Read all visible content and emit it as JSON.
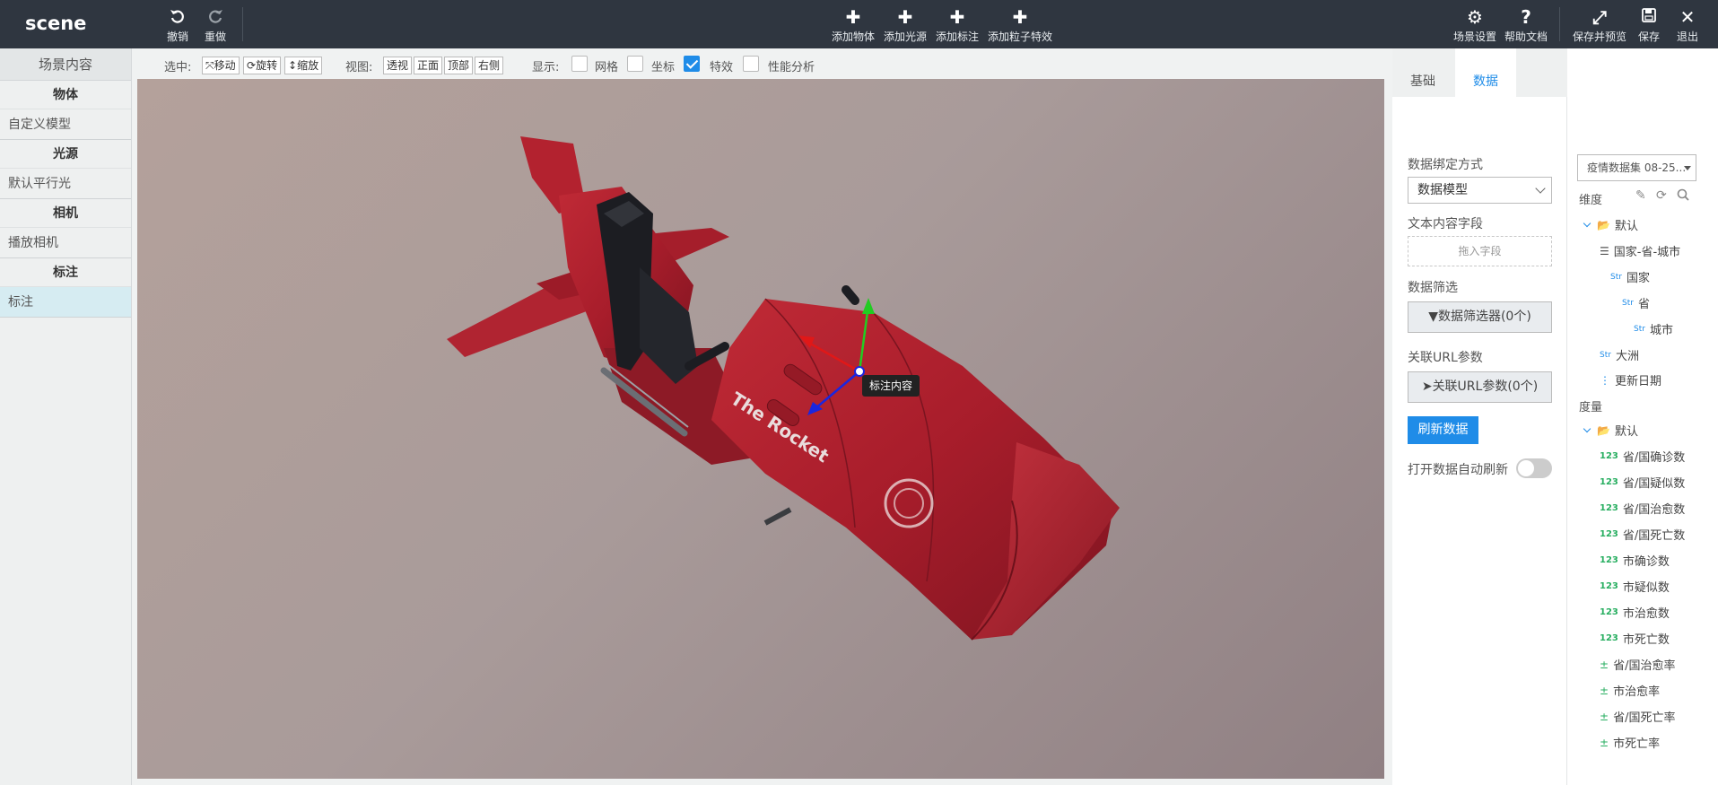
{
  "app": {
    "logo": "scene"
  },
  "topbar": {
    "undo": "撤销",
    "redo": "重做",
    "add_object": "添加物体",
    "add_light": "添加光源",
    "add_label": "添加标注",
    "add_particle": "添加粒子特效",
    "scene_settings": "场景设置",
    "help_docs": "帮助文档",
    "save_preview": "保存并预览",
    "save": "保存",
    "exit": "退出"
  },
  "left_panel": {
    "title": "场景内容",
    "groups": [
      {
        "name": "物体",
        "items": [
          "自定义模型"
        ]
      },
      {
        "name": "光源",
        "items": [
          "默认平行光"
        ]
      },
      {
        "name": "相机",
        "items": [
          "播放相机"
        ]
      },
      {
        "name": "标注",
        "items": [
          "标注"
        ]
      }
    ]
  },
  "toolbar": {
    "select_label": "选中:",
    "move": "移动",
    "rotate": "旋转",
    "scale": "缩放",
    "view_label": "视图:",
    "perspective": "透视",
    "front": "正面",
    "top": "顶部",
    "right": "右侧",
    "display_label": "显示:",
    "grid": "网格",
    "axes": "坐标",
    "effects": "特效",
    "perf": "性能分析",
    "grid_checked": false,
    "axes_checked": false,
    "effects_checked": true,
    "perf_checked": false
  },
  "viewport": {
    "label_text": "标注内容",
    "model_text": "The Rocket"
  },
  "right_panel": {
    "tabs": [
      "基础",
      "数据"
    ],
    "active_tab": "数据",
    "bind_mode_label": "数据绑定方式",
    "bind_mode_value": "数据模型",
    "text_field_label": "文本内容字段",
    "drop_placeholder": "拖入字段",
    "filter_label": "数据筛选",
    "filter_button": "数据筛选器(0个)",
    "url_label": "关联URL参数",
    "url_button": "关联URL参数(0个)",
    "refresh_button": "刷新数据",
    "auto_refresh_label": "打开数据自动刷新",
    "auto_refresh_on": false
  },
  "fields": {
    "dataset": "疫情数据集 08-25...",
    "dimension_label": "维度",
    "measure_label": "度量",
    "dimensions": [
      {
        "type": "folder",
        "name": "默认"
      },
      {
        "type": "hier",
        "name": "国家-省-城市"
      },
      {
        "type": "Str",
        "name": "国家"
      },
      {
        "type": "Str",
        "name": "省"
      },
      {
        "type": "Str",
        "name": "城市"
      },
      {
        "type": "Str",
        "name": "大洲"
      },
      {
        "type": "date",
        "name": "更新日期"
      }
    ],
    "measures": [
      {
        "type": "folder",
        "name": "默认"
      },
      {
        "type": "123",
        "name": "省/国确诊数"
      },
      {
        "type": "123",
        "name": "省/国疑似数"
      },
      {
        "type": "123",
        "name": "省/国治愈数"
      },
      {
        "type": "123",
        "name": "省/国死亡数"
      },
      {
        "type": "123",
        "name": "市确诊数"
      },
      {
        "type": "123",
        "name": "市疑似数"
      },
      {
        "type": "123",
        "name": "市治愈数"
      },
      {
        "type": "123",
        "name": "市死亡数"
      },
      {
        "type": "calc",
        "name": "省/国治愈率"
      },
      {
        "type": "calc",
        "name": "市治愈率"
      },
      {
        "type": "calc",
        "name": "省/国死亡率"
      },
      {
        "type": "calc",
        "name": "市死亡率"
      }
    ]
  },
  "icons": {
    "undo": "undo-icon",
    "redo": "redo-icon",
    "plus": "plus-icon",
    "gear": "gear-icon",
    "help": "question-icon",
    "expand": "expand-icon",
    "save": "floppy-icon",
    "close": "close-icon"
  },
  "colors": {
    "topbar": "#2f3640",
    "accent": "#1f8ce8",
    "model_red": "#b01e2c"
  }
}
